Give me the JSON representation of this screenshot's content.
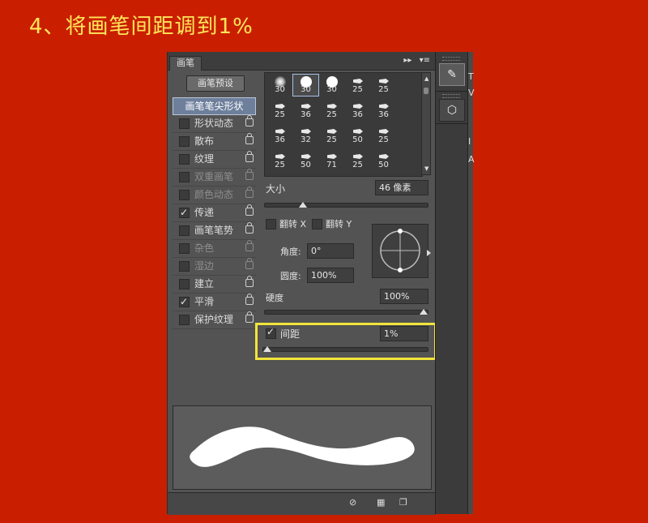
{
  "title": "4、将画笔间距调到1%",
  "panel": {
    "tab": "画笔",
    "preset_button": "画笔预设",
    "options": [
      {
        "label": "画笔笔尖形状",
        "type": "active"
      },
      {
        "label": "形状动态",
        "checked": false,
        "dim": false
      },
      {
        "label": "散布",
        "checked": false,
        "dim": false
      },
      {
        "label": "纹理",
        "checked": false,
        "dim": false
      },
      {
        "label": "双重画笔",
        "checked": false,
        "dim": true
      },
      {
        "label": "颜色动态",
        "checked": false,
        "dim": true
      },
      {
        "label": "传递",
        "checked": true,
        "dim": false
      },
      {
        "label": "画笔笔势",
        "checked": false,
        "dim": false
      },
      {
        "label": "杂色",
        "checked": false,
        "dim": true
      },
      {
        "label": "湿边",
        "checked": false,
        "dim": true
      },
      {
        "label": "建立",
        "checked": false,
        "dim": false
      },
      {
        "label": "平滑",
        "checked": true,
        "dim": false
      },
      {
        "label": "保护纹理",
        "checked": false,
        "dim": false
      }
    ],
    "brushes": [
      {
        "size": "30",
        "shape": "soft"
      },
      {
        "size": "30",
        "shape": "round",
        "selected": true
      },
      {
        "size": "30",
        "shape": "round"
      },
      {
        "size": "25",
        "shape": "tip"
      },
      {
        "size": "25",
        "shape": "tip"
      },
      {
        "size": "25",
        "shape": "tip"
      },
      {
        "size": "36",
        "shape": "tip"
      },
      {
        "size": "25",
        "shape": "tip"
      },
      {
        "size": "36",
        "shape": "tip"
      },
      {
        "size": "36",
        "shape": "tip"
      },
      {
        "size": "36",
        "shape": "tip"
      },
      {
        "size": "32",
        "shape": "tip"
      },
      {
        "size": "25",
        "shape": "tip"
      },
      {
        "size": "50",
        "shape": "tip"
      },
      {
        "size": "25",
        "shape": "tip"
      },
      {
        "size": "25",
        "shape": "tip"
      },
      {
        "size": "50",
        "shape": "tip"
      },
      {
        "size": "71",
        "shape": "tip"
      },
      {
        "size": "25",
        "shape": "tip"
      },
      {
        "size": "50",
        "shape": "tip"
      }
    ],
    "size_label": "大小",
    "size_value": "46 像素",
    "size_slider": 0.22,
    "flip_x_label": "翻转 X",
    "flip_y_label": "翻转 Y",
    "angle_label": "角度:",
    "angle_value": "0°",
    "roundness_label": "圆度:",
    "roundness_value": "100%",
    "hardness_label": "硬度",
    "hardness_value": "100%",
    "hardness_slider": 1.0,
    "spacing_label": "间距",
    "spacing_checked": true,
    "spacing_value": "1%",
    "spacing_slider": 0.0
  },
  "colors": {
    "background": "#c91f00",
    "title": "#ffe65a",
    "highlight": "#f2e43c"
  },
  "strip_letters": [
    "T",
    "V",
    "I",
    "A"
  ]
}
